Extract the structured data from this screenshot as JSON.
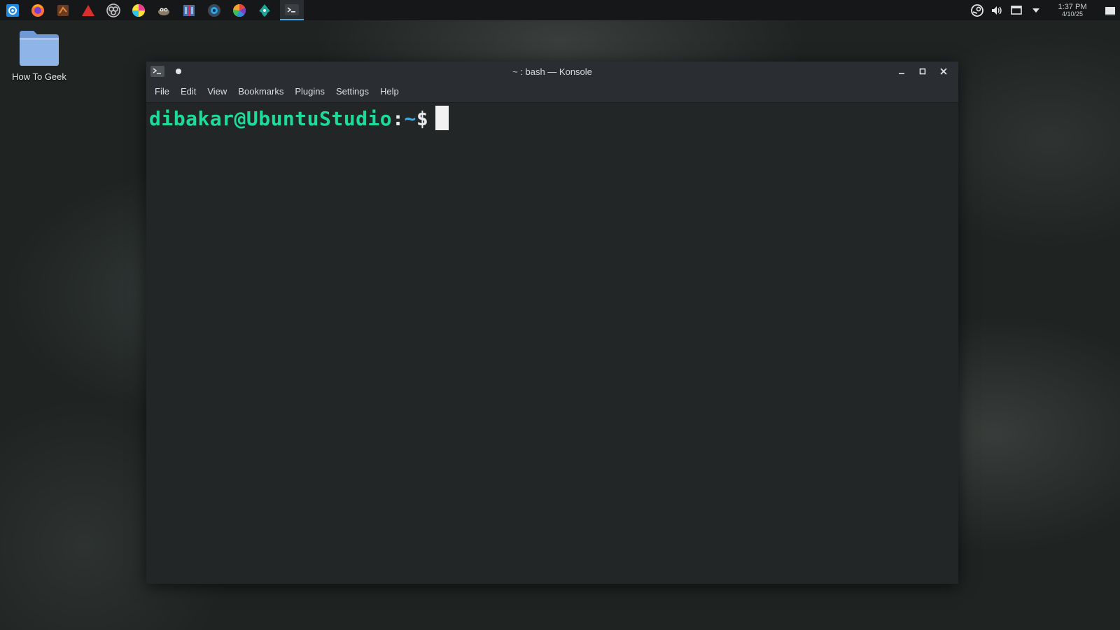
{
  "taskbar": {
    "launchers": [
      {
        "name": "app-launcher-icon",
        "color": "#1e88e5"
      },
      {
        "name": "firefox-icon",
        "color": "#ff7139"
      },
      {
        "name": "blender-icon",
        "color": "#8b4a2a"
      },
      {
        "name": "ardour-icon",
        "color": "#d92e2e"
      },
      {
        "name": "obs-icon",
        "color": "#cccccc"
      },
      {
        "name": "krita-icon",
        "color": "#e83e8c"
      },
      {
        "name": "gimp-icon",
        "color": "#8a7c66"
      },
      {
        "name": "kdenlive-icon",
        "color": "#4c6ea8"
      },
      {
        "name": "audacity-icon",
        "color": "#2a6ea8"
      },
      {
        "name": "darktable-icon",
        "color": "#f3a32b"
      },
      {
        "name": "inkscape-icon",
        "color": "#1fa39a"
      },
      {
        "name": "konsole-icon",
        "color": "#e0e0e0",
        "active": true
      }
    ],
    "tray": {
      "icons": [
        "steam-icon",
        "volume-icon",
        "display-icon",
        "tray-expand-icon",
        "show-desktop-icon"
      ],
      "time": "1:37 PM",
      "date": "4/10/25"
    }
  },
  "desktop": {
    "icon_label": "How To Geek",
    "folder_color": "#8fb4e8"
  },
  "window": {
    "title": "~ : bash — Konsole",
    "menu": [
      "File",
      "Edit",
      "View",
      "Bookmarks",
      "Plugins",
      "Settings",
      "Help"
    ],
    "terminal": {
      "user_host": "dibakar@UbuntuStudio",
      "colon": ":",
      "path": "~",
      "dollar": "$"
    }
  }
}
